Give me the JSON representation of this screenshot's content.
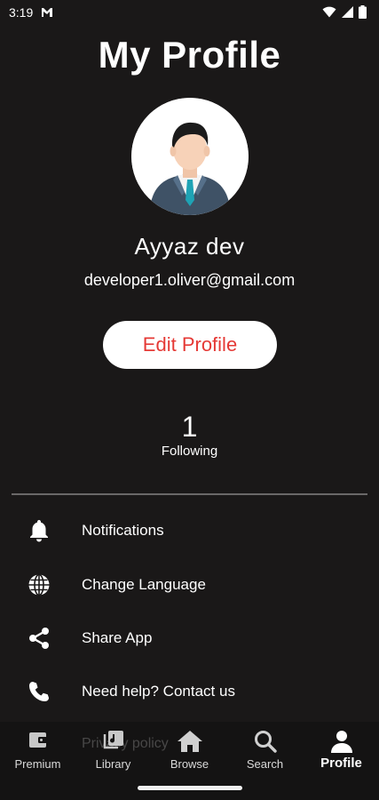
{
  "status_bar": {
    "time": "3:19"
  },
  "header": {
    "title": "My Profile"
  },
  "profile": {
    "name": "Ayyaz dev",
    "email": "developer1.oliver@gmail.com",
    "edit_label": "Edit Profile",
    "following_count": "1",
    "following_label": "Following"
  },
  "menu": {
    "items": [
      {
        "label": "Notifications",
        "icon": "bell-icon"
      },
      {
        "label": "Change Language",
        "icon": "globe-icon"
      },
      {
        "label": "Share App",
        "icon": "share-icon"
      },
      {
        "label": "Need help? Contact us",
        "icon": "phone-icon"
      }
    ],
    "partial_item": "Privacy policy"
  },
  "nav": {
    "items": [
      {
        "label": "Premium",
        "icon": "wallet-icon"
      },
      {
        "label": "Library",
        "icon": "library-icon"
      },
      {
        "label": "Browse",
        "icon": "home-icon"
      },
      {
        "label": "Search",
        "icon": "search-icon"
      },
      {
        "label": "Profile",
        "icon": "person-icon",
        "active": true
      }
    ]
  },
  "colors": {
    "background": "#1a1818",
    "accent_red": "#e53935",
    "button_bg": "#ffffff",
    "nav_bg": "#141313"
  }
}
